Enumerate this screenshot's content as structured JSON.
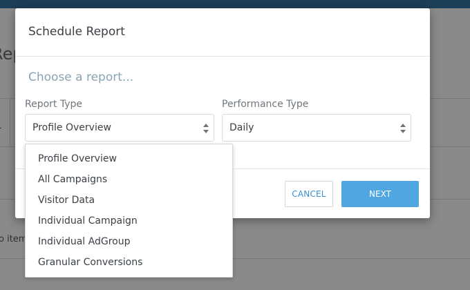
{
  "background": {
    "title_fragment": "Rep",
    "no_items_fragment": "o item",
    "dash_fragment": "-"
  },
  "modal": {
    "title": "Schedule Report",
    "choose_placeholder": "Choose a report...",
    "report_type": {
      "label": "Report Type",
      "selected": "Profile Overview"
    },
    "performance_type": {
      "label": "Performance Type",
      "selected": "Daily"
    },
    "cancel_label": "CANCEL",
    "next_label": "NEXT"
  },
  "dropdown": {
    "items": [
      {
        "label": "Profile Overview"
      },
      {
        "label": "All Campaigns"
      },
      {
        "label": "Visitor Data"
      },
      {
        "label": "Individual Campaign"
      },
      {
        "label": "Individual AdGroup"
      },
      {
        "label": "Granular Conversions"
      }
    ]
  },
  "colors": {
    "accent": "#4fa6e0",
    "link": "#3b8fd0",
    "topbar": "#1d3e57"
  }
}
